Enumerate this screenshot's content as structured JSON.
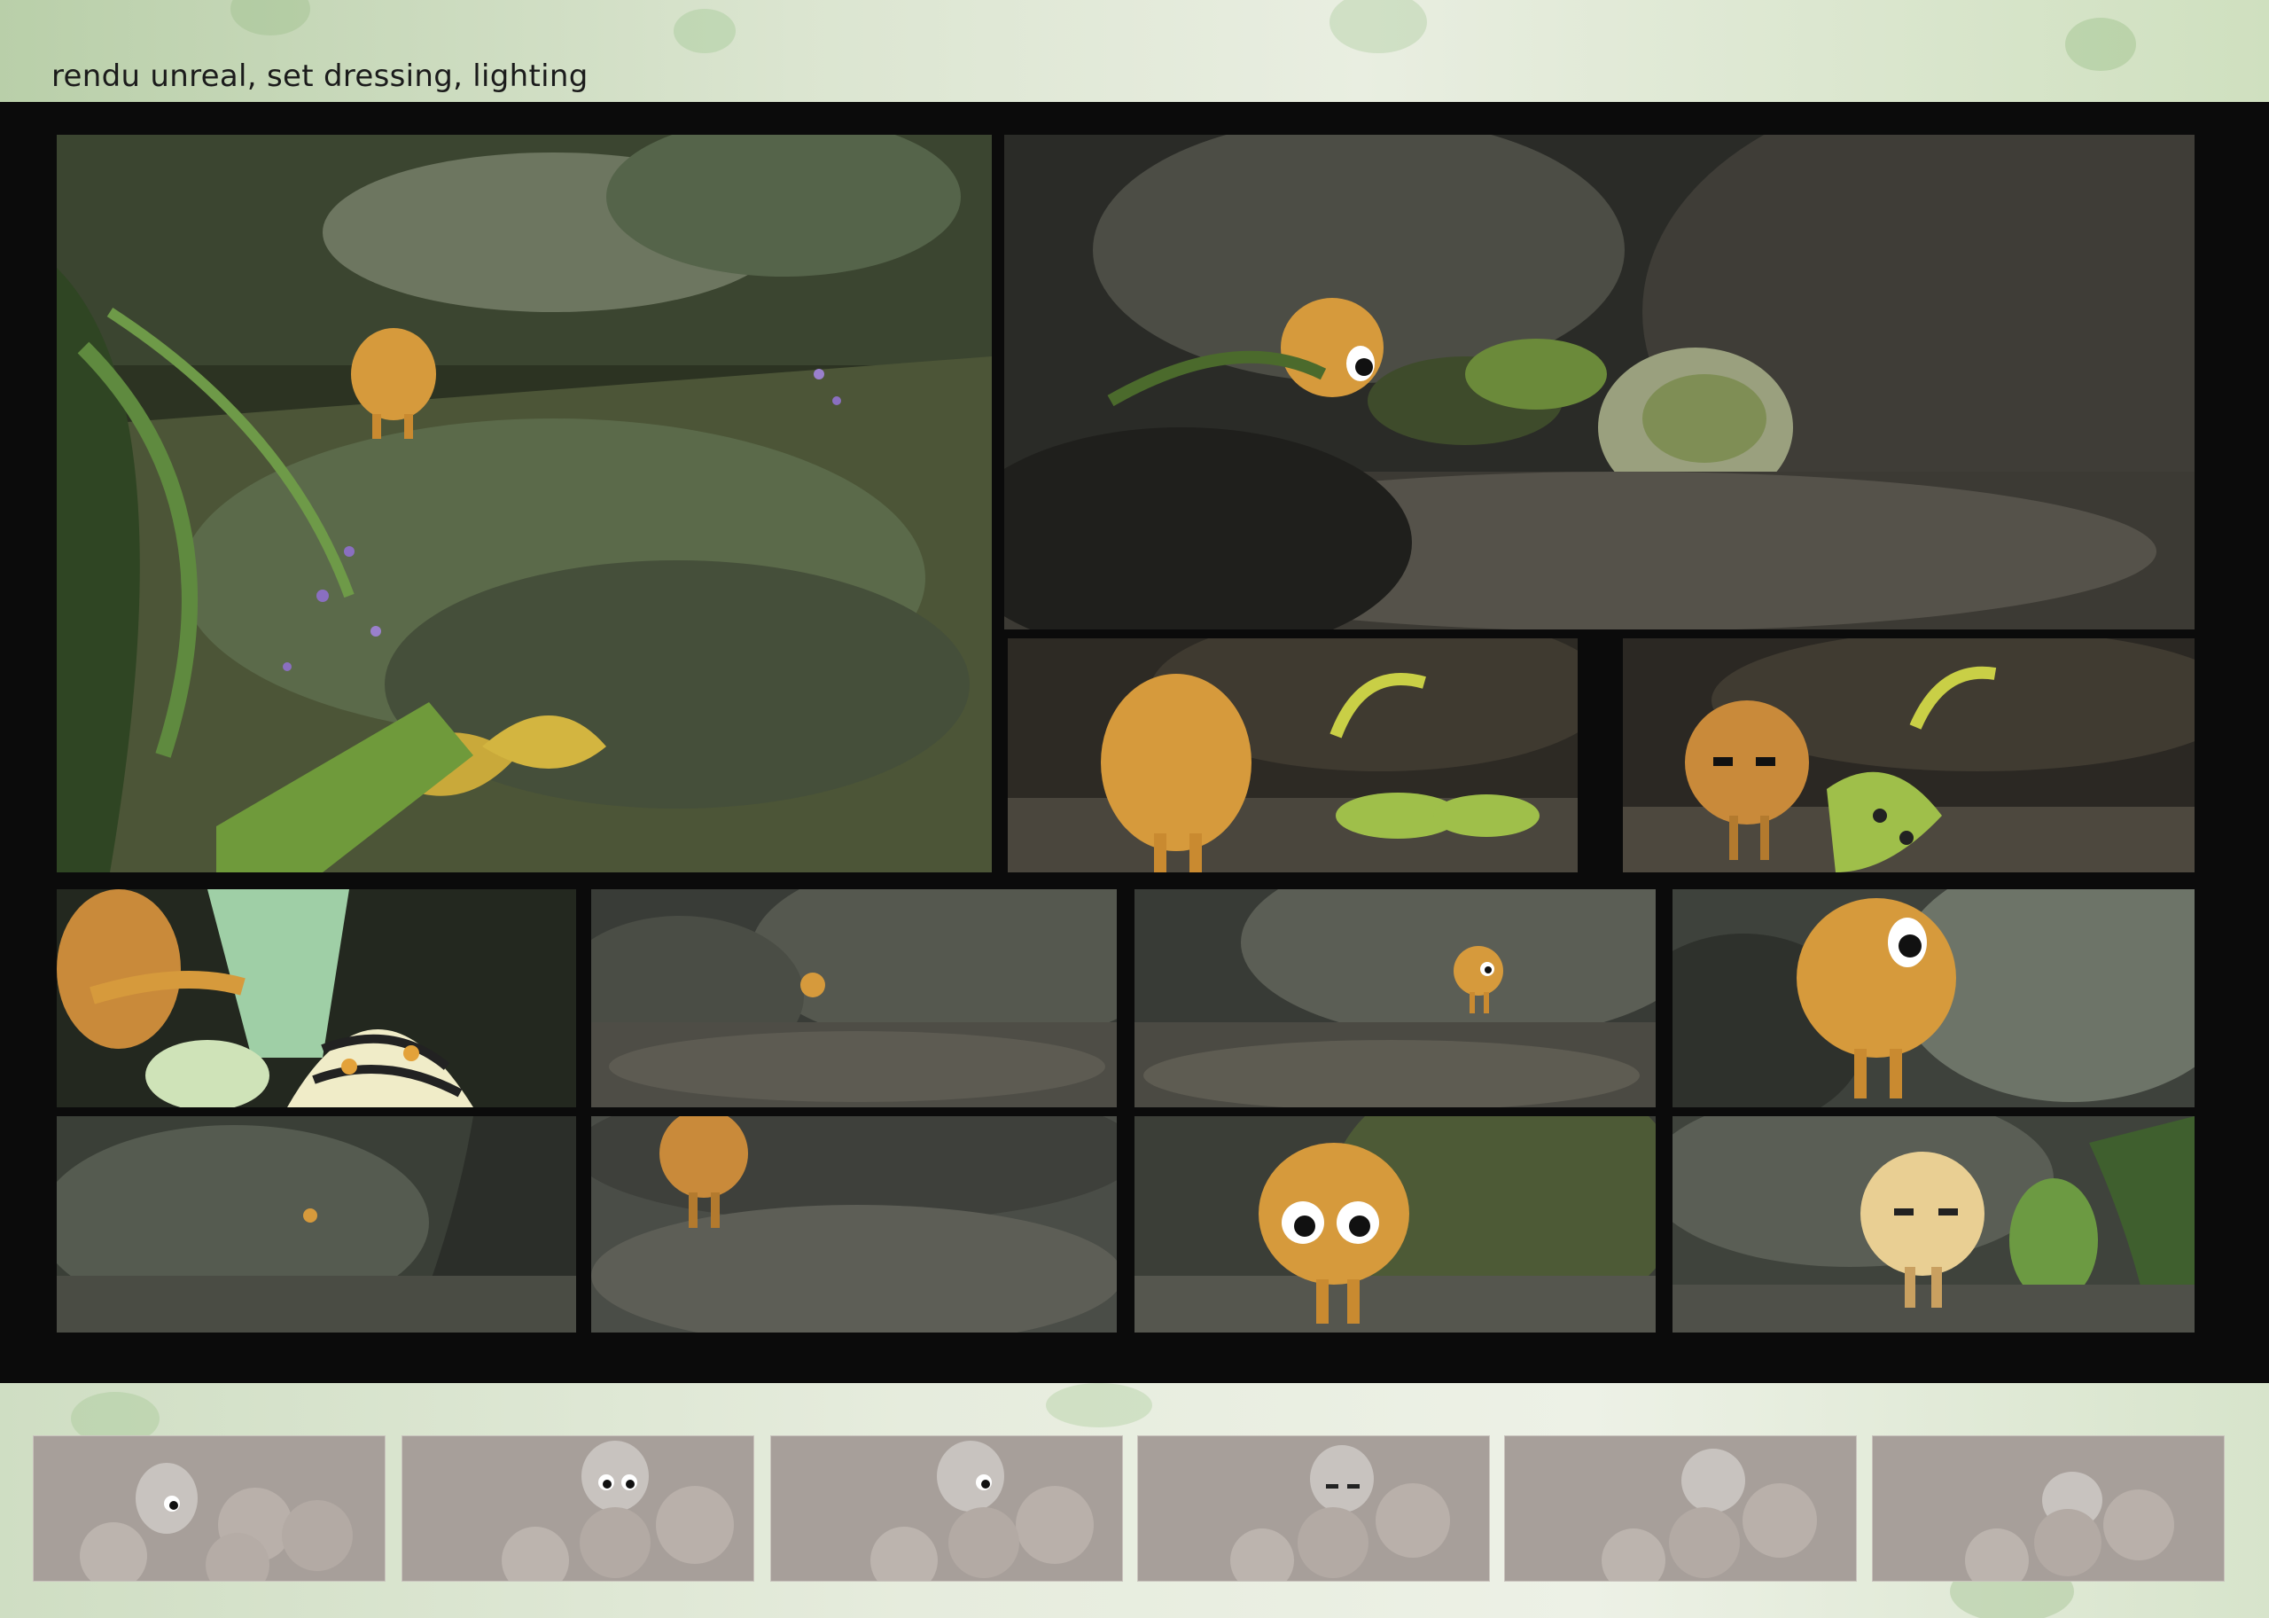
{
  "header": {
    "title": "rendu unreal, set dressing, lighting"
  },
  "colors": {
    "banner_green": "#c8dab8",
    "board_black": "#0b0b0b",
    "character_orange": "#d69a3c",
    "caterpillar_green": "#9fbf4a",
    "clay_grey": "#a79f9a"
  },
  "render_panels": [
    {
      "id": "forest-stream-wide",
      "scene": "character by mossy stream with ferns and purple flowers"
    },
    {
      "id": "peek-behind-rock",
      "scene": "character peeking behind dark rocks"
    },
    {
      "id": "back-view-caterpillars",
      "scene": "character seen from behind facing caterpillars"
    },
    {
      "id": "touching-caterpillar",
      "scene": "character reaching toward caterpillar"
    },
    {
      "id": "hand-closeup",
      "scene": "close-up hand near striped caterpillar"
    },
    {
      "id": "tiny-on-rocks",
      "scene": "small character far away on rocks"
    },
    {
      "id": "walking-on-rocks",
      "scene": "character walking on rock path"
    },
    {
      "id": "closeup-worried",
      "scene": "close-up of worried character"
    },
    {
      "id": "tiny-in-forest",
      "scene": "tiny character among tree roots"
    },
    {
      "id": "walking-away",
      "scene": "character walking away from camera"
    },
    {
      "id": "sad-big-eyes",
      "scene": "character with sad big eyes"
    },
    {
      "id": "pale-lighting",
      "scene": "character in pale backlight"
    }
  ],
  "clay_thumbnails": [
    {
      "id": "clay-1"
    },
    {
      "id": "clay-2"
    },
    {
      "id": "clay-3"
    },
    {
      "id": "clay-4"
    },
    {
      "id": "clay-5"
    },
    {
      "id": "clay-6"
    }
  ]
}
